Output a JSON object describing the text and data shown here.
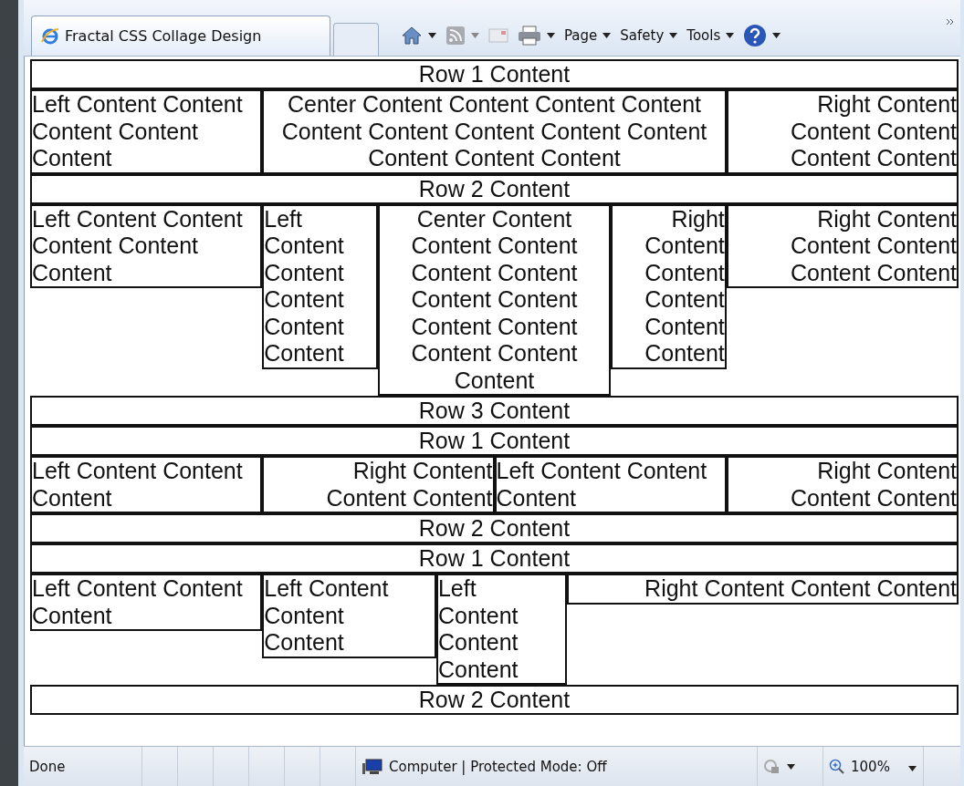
{
  "tab": {
    "title": "Fractal CSS Collage Design",
    "selected": true
  },
  "toolbar": {
    "items": [
      {
        "kind": "home",
        "dropdown": true,
        "disabled": false
      },
      {
        "kind": "feeds",
        "dropdown": true,
        "disabled": true
      },
      {
        "kind": "mail",
        "dropdown": false,
        "disabled": true
      },
      {
        "kind": "print",
        "dropdown": true,
        "disabled": false
      },
      {
        "kind": "menu",
        "label": "Page",
        "dropdown": true,
        "disabled": false
      },
      {
        "kind": "menu",
        "label": "Safety",
        "dropdown": true,
        "disabled": false
      },
      {
        "kind": "menu",
        "label": "Tools",
        "dropdown": true,
        "disabled": false
      },
      {
        "kind": "help",
        "dropdown": true,
        "disabled": false
      }
    ]
  },
  "sections": [
    {
      "rows": [
        {
          "kind": "bar",
          "text": "Row 1 Content"
        },
        {
          "kind": "columns",
          "cells": [
            {
              "kind": "left",
              "text": "Left Content Content Content Content Content"
            },
            {
              "kind": "center",
              "text": "Center Content Content Content Content Content Content Content Content Content Content Content Content"
            },
            {
              "kind": "right",
              "text": "Right Content Content Content Content Content"
            }
          ]
        },
        {
          "kind": "bar",
          "text": "Row 2 Content"
        },
        {
          "kind": "columns",
          "cells": [
            {
              "kind": "left",
              "text": "Left Content Content Content Content Content"
            },
            {
              "kind": "group",
              "cells": [
                {
                  "kind": "left",
                  "text": "Left Content Content Content Content Content"
                },
                {
                  "kind": "center",
                  "text": "Center Content Content Content Content Content Content Content Content Content Content Content Content"
                },
                {
                  "kind": "right",
                  "text": "Right Content Content Content Content Content"
                }
              ]
            },
            {
              "kind": "right",
              "text": "Right Content Content Content Content Content"
            }
          ]
        },
        {
          "kind": "bar",
          "text": "Row 3 Content"
        }
      ]
    },
    {
      "rows": [
        {
          "kind": "bar",
          "text": "Row 1 Content"
        },
        {
          "kind": "columns",
          "cells": [
            {
              "kind": "group",
              "cells": [
                {
                  "kind": "left",
                  "text": "Left Content Content Content"
                },
                {
                  "kind": "right",
                  "text": "Right Content Content Content"
                }
              ]
            },
            {
              "kind": "group",
              "cells": [
                {
                  "kind": "left",
                  "text": "Left Content Content Content"
                },
                {
                  "kind": "right",
                  "text": "Right Content Content Content"
                }
              ]
            }
          ]
        },
        {
          "kind": "bar",
          "text": "Row 2 Content"
        }
      ]
    },
    {
      "rows": [
        {
          "kind": "bar",
          "text": "Row 1 Content"
        },
        {
          "kind": "columns",
          "cells": [
            {
              "kind": "left",
              "text": "Left Content Content Content"
            },
            {
              "kind": "group",
              "cells": [
                {
                  "kind": "left",
                  "text": "Left Content Content Content"
                },
                {
                  "kind": "group",
                  "cells": [
                    {
                      "kind": "left",
                      "text": "Left Content Content Content"
                    },
                    {
                      "kind": "right",
                      "text": "Right Content Content Content"
                    }
                  ]
                }
              ]
            }
          ]
        },
        {
          "kind": "bar",
          "text": "Row 2 Content"
        }
      ]
    }
  ],
  "status": {
    "text": "Done",
    "zone": "Computer | Protected Mode: Off",
    "zoom": "100%"
  }
}
